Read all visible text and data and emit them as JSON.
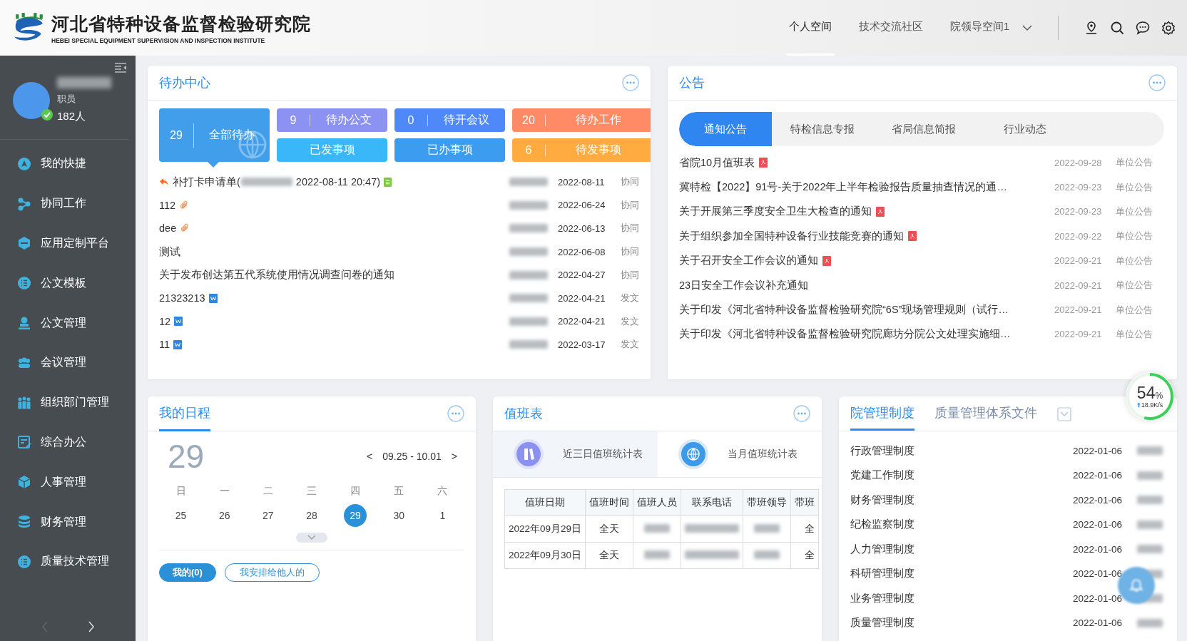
{
  "header": {
    "title": "河北省特种设备监督检验研究院",
    "subtitle": "HEBEI SPECIAL EQUIPMENT SUPERVISION AND INSPECTION  INSTITUTE",
    "nav": [
      {
        "label": "个人空间",
        "selected": true
      },
      {
        "label": "技术交流社区",
        "selected": false
      },
      {
        "label": "院领导空间1",
        "selected": false
      }
    ]
  },
  "sidebar": {
    "user": {
      "role": "职员",
      "count": "182人",
      "online": true
    },
    "items": [
      "我的快捷",
      "协同工作",
      "应用定制平台",
      "公文模板",
      "公文管理",
      "会议管理",
      "组织部门管理",
      "综合办公",
      "人事管理",
      "财务管理",
      "质量技术管理"
    ]
  },
  "todo": {
    "title": "待办中心",
    "tiles": [
      {
        "kind": "big",
        "count": "29",
        "label": "全部待办",
        "color": "#409eea",
        "selected": true
      },
      {
        "kind": "small",
        "count": "9",
        "label": "待办公文",
        "color": "#8c92f2",
        "selected": false
      },
      {
        "kind": "small",
        "count": "0",
        "label": "待开会议",
        "color": "#4f88f8",
        "selected": false
      },
      {
        "kind": "small",
        "count": "20",
        "label": "待办工作",
        "color": "#ff8a66",
        "selected": false
      },
      {
        "kind": "small",
        "label": "已发事项",
        "color": "#3ab7f8",
        "selected": false
      },
      {
        "kind": "small",
        "label": "已办事项",
        "color": "#3b9cf0",
        "selected": false
      },
      {
        "kind": "small",
        "count": "6",
        "label": "待发事项",
        "color": "#ffab40",
        "selected": false
      }
    ],
    "rows": [
      {
        "replied": true,
        "title": "补打卡申请单(",
        "title_tail": "2022-08-11 20:47)",
        "attachment": {
          "kind": "sheet"
        },
        "date": "2022-08-11",
        "type": "协同"
      },
      {
        "title": "112",
        "attachment": {
          "kind": "clip"
        },
        "date": "2022-06-24",
        "type": "协同"
      },
      {
        "title": "dee",
        "attachment": {
          "kind": "clip"
        },
        "date": "2022-06-13",
        "type": "协同"
      },
      {
        "title": "测试",
        "date": "2022-06-08",
        "type": "协同"
      },
      {
        "title": "关于发布创达第五代系统使用情况调查问卷的通知",
        "date": "2022-04-27",
        "type": "协同"
      },
      {
        "title": "21323213",
        "attachment": {
          "kind": "word"
        },
        "date": "2022-04-21",
        "type": "发文"
      },
      {
        "title": "12",
        "attachment": {
          "kind": "word"
        },
        "date": "2022-04-21",
        "type": "发文"
      },
      {
        "title": "11",
        "attachment": {
          "kind": "word"
        },
        "date": "2022-03-17",
        "type": "发文"
      }
    ]
  },
  "notice": {
    "title": "公告",
    "tabs": [
      {
        "label": "通知公告",
        "selected": true
      },
      {
        "label": "特检信息专报",
        "selected": false
      },
      {
        "label": "省局信息简报",
        "selected": false
      },
      {
        "label": "行业动态",
        "selected": false
      }
    ],
    "rows": [
      {
        "title": "省院10月值班表",
        "attachment": {
          "kind": "pdf"
        },
        "date": "2022-09-28",
        "category": "单位公告"
      },
      {
        "title": "冀特检【2022】91号-关于2022年上半年检验报告质量抽查情况的通…",
        "date": "2022-09-23",
        "category": "单位公告"
      },
      {
        "title": "关于开展第三季度安全卫生大检查的通知",
        "attachment": {
          "kind": "pdf"
        },
        "date": "2022-09-23",
        "category": "单位公告"
      },
      {
        "title": "关于组织参加全国特种设备行业技能竞赛的通知",
        "attachment": {
          "kind": "pdf"
        },
        "date": "2022-09-22",
        "category": "单位公告"
      },
      {
        "title": "关于召开安全工作会议的通知",
        "attachment": {
          "kind": "pdf"
        },
        "date": "2022-09-21",
        "category": "单位公告"
      },
      {
        "title": "23日安全工作会议补充通知",
        "date": "2022-09-21",
        "category": "单位公告"
      },
      {
        "title": "关于印发《河北省特种设备监督检验研究院“6S”现场管理规则（试行…",
        "date": "2022-09-21",
        "category": "单位公告"
      },
      {
        "title": "关于印发《河北省特种设备监督检验研究院廊坊分院公文处理实施细…",
        "date": "2022-09-21",
        "category": "单位公告"
      }
    ]
  },
  "schedule": {
    "title": "我的日程",
    "day": "29",
    "prev": "<",
    "range": "09.25 - 10.01",
    "next": ">",
    "weekdays": [
      "日",
      "一",
      "二",
      "三",
      "四",
      "五",
      "六"
    ],
    "days": [
      {
        "label": "25",
        "selected": false
      },
      {
        "label": "26",
        "selected": false
      },
      {
        "label": "27",
        "selected": false
      },
      {
        "label": "28",
        "selected": false
      },
      {
        "label": "29",
        "selected": true
      },
      {
        "label": "30",
        "selected": false
      },
      {
        "label": "1",
        "selected": false
      }
    ],
    "buttons": [
      {
        "label": "我的(0)",
        "selected": true
      },
      {
        "label": "我安排给他人的",
        "selected": false
      }
    ]
  },
  "duty": {
    "title": "值班表",
    "tabs": [
      {
        "label": "近三日值班统计表",
        "selected": true
      },
      {
        "label": "当月值班统计表",
        "selected": false
      }
    ],
    "columns": [
      "值班日期",
      "值班时间",
      "值班人员",
      "联系电话",
      "带班领导",
      "带班"
    ],
    "rows": [
      {
        "date": "2022年09月29日",
        "time": "全天",
        "column_6": "全"
      },
      {
        "date": "2022年09月30日",
        "time": "全天",
        "column_6": "全"
      }
    ]
  },
  "rules": {
    "tabs": [
      {
        "label": "院管理制度",
        "selected": true
      },
      {
        "label": "质量管理体系文件",
        "selected": false
      }
    ],
    "rows": [
      {
        "title": "行政管理制度",
        "date": "2022-01-06"
      },
      {
        "title": "党建工作制度",
        "date": "2022-01-06"
      },
      {
        "title": "财务管理制度",
        "date": "2022-01-06"
      },
      {
        "title": "纪检监察制度",
        "date": "2022-01-06"
      },
      {
        "title": "人力管理制度",
        "date": "2022-01-06"
      },
      {
        "title": "科研管理制度",
        "date": "2022-01-06"
      },
      {
        "title": "业务管理制度",
        "date": "2022-01-06"
      },
      {
        "title": "质量管理制度",
        "date": "2022-01-06"
      }
    ]
  },
  "speed": {
    "percent": "54",
    "unit": "%",
    "rate": "18.9K/s",
    "level": 0.54
  }
}
